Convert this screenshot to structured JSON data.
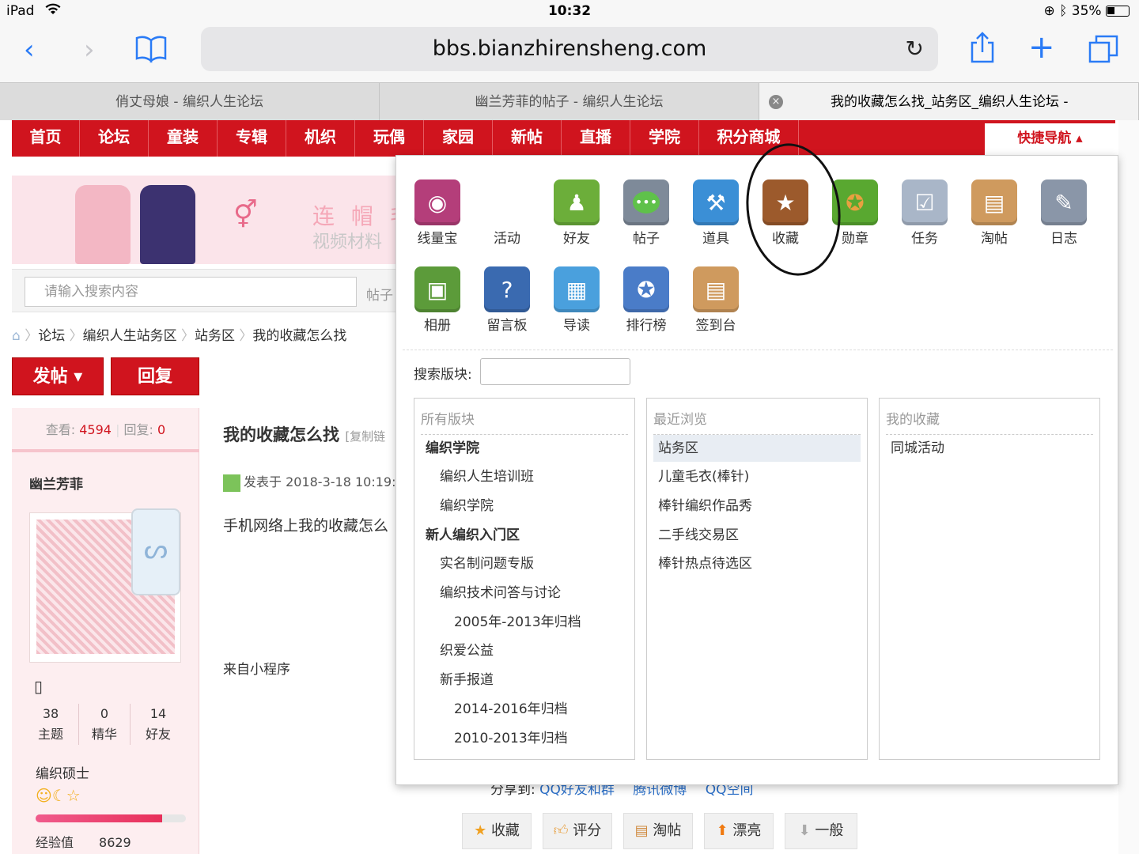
{
  "status": {
    "device": "iPad",
    "time": "10:32",
    "battery": "35%"
  },
  "browser": {
    "url": "bbs.bianzhirensheng.com"
  },
  "tabs": [
    {
      "label": "俏丈母娘 - 编织人生论坛"
    },
    {
      "label": "幽兰芳菲的帖子 - 编织人生论坛"
    },
    {
      "label": "我的收藏怎么找_站务区_编织人生论坛 -"
    }
  ],
  "nav": {
    "items": [
      "首页",
      "论坛",
      "童装",
      "专辑",
      "机织",
      "玩偶",
      "家园",
      "新帖",
      "直播",
      "学院",
      "积分商城"
    ],
    "quick": "快捷导航 ▴"
  },
  "banner": {
    "text1": "连 帽 毛",
    "text2": "视频材料"
  },
  "search": {
    "placeholder": "请输入搜索内容",
    "type": "帖子"
  },
  "breadcrumb": [
    "论坛",
    "编织人生站务区",
    "站务区",
    "我的收藏怎么找"
  ],
  "actions": {
    "post": "发帖 ▾",
    "reply": "回复"
  },
  "post": {
    "views_label": "查看:",
    "views": "4594",
    "replies_label": "回复:",
    "replies": "0",
    "author": "幽兰芳菲",
    "title": "我的收藏怎么找",
    "title_suffix": "[复制链",
    "meta": "发表于 2018-3-18 10:19:1",
    "body": "手机网络上我的收藏怎么",
    "from": "来自小程序",
    "stats": [
      {
        "n": "38",
        "l": "主题"
      },
      {
        "n": "0",
        "l": "精华"
      },
      {
        "n": "14",
        "l": "好友"
      }
    ],
    "rank": "编织硕士",
    "exp_label": "经验值",
    "exp": "8629",
    "exp_progress": 0.84
  },
  "share": {
    "label": "分享到:",
    "targets": [
      "QQ好友和群",
      "腾讯微博",
      "QQ空间"
    ]
  },
  "bottom_buttons": [
    "收藏",
    "评分",
    "淘帖",
    "漂亮",
    "一般"
  ],
  "panel": {
    "icons_row1": [
      {
        "label": "线量宝",
        "icon": "yarn-icon",
        "color": "#b43e7a"
      },
      {
        "label": "活动",
        "icon": "activity-icon",
        "color": ""
      },
      {
        "label": "好友",
        "icon": "friends-icon",
        "color": "#6cae3a"
      },
      {
        "label": "帖子",
        "icon": "post-icon",
        "color": "#7e8a99"
      },
      {
        "label": "道具",
        "icon": "magic-wand-icon",
        "color": "#3b8fd6"
      },
      {
        "label": "收藏",
        "icon": "star-icon",
        "color": "#9c5a2c"
      },
      {
        "label": "勋章",
        "icon": "medal-icon",
        "color": "#59a830"
      },
      {
        "label": "任务",
        "icon": "task-icon",
        "color": "#a9b6c8"
      },
      {
        "label": "淘帖",
        "icon": "tray-icon",
        "color": "#cf9a5e"
      },
      {
        "label": "日志",
        "icon": "journal-icon",
        "color": "#8a96a8"
      }
    ],
    "icons_row2": [
      {
        "label": "相册",
        "icon": "album-icon",
        "color": "#5c9b3a"
      },
      {
        "label": "留言板",
        "icon": "guestbook-icon",
        "color": "#3a6ab0"
      },
      {
        "label": "导读",
        "icon": "guide-icon",
        "color": "#4aa0dd"
      },
      {
        "label": "排行榜",
        "icon": "ranking-icon",
        "color": "#4a7cc8"
      },
      {
        "label": "签到台",
        "icon": "checkin-icon",
        "color": "#cf9a5e"
      }
    ],
    "search_label": "搜索版块:",
    "columns": [
      {
        "title": "所有版块",
        "items": [
          {
            "t": "编织学院",
            "lvl": 0
          },
          {
            "t": "编织人生培训班",
            "lvl": 1
          },
          {
            "t": "编织学院",
            "lvl": 1
          },
          {
            "t": "新人编织入门区",
            "lvl": 0
          },
          {
            "t": "实名制问题专版",
            "lvl": 1
          },
          {
            "t": "编织技术问答与讨论",
            "lvl": 1
          },
          {
            "t": "2005年-2013年归档",
            "lvl": 2
          },
          {
            "t": "织爱公益",
            "lvl": 1
          },
          {
            "t": "新手报道",
            "lvl": 1
          },
          {
            "t": "2014-2016年归档",
            "lvl": 2
          },
          {
            "t": "2010-2013年归档",
            "lvl": 2
          }
        ]
      },
      {
        "title": "最近浏览",
        "items": [
          {
            "t": "站务区",
            "lvl": -1
          },
          {
            "t": "儿童毛衣(棒针)",
            "lvl": 0
          },
          {
            "t": "棒针编织作品秀",
            "lvl": 0
          },
          {
            "t": "二手线交易区",
            "lvl": 0
          },
          {
            "t": "棒针热点待选区",
            "lvl": 0
          }
        ]
      },
      {
        "title": "我的收藏",
        "items": [
          {
            "t": "同城活动",
            "lvl": 0
          }
        ]
      }
    ]
  },
  "colors": {
    "brand": "#d0141e",
    "link": "#2a6fc9"
  }
}
